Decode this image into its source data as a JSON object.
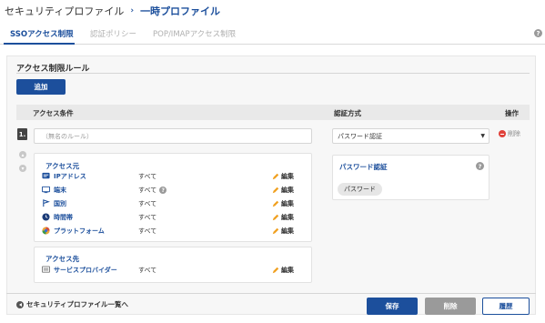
{
  "breadcrumb": {
    "parent": "セキュリティプロファイル",
    "separator": "›",
    "current": "一時プロファイル"
  },
  "tabs": [
    {
      "label": "SSOアクセス制限",
      "active": true
    },
    {
      "label": "認証ポリシー",
      "active": false
    },
    {
      "label": "POP/IMAPアクセス制限",
      "active": false
    }
  ],
  "help": "?",
  "section": {
    "title": "アクセス制限ルール",
    "add_label": "追加"
  },
  "table": {
    "col_condition": "アクセス条件",
    "col_auth": "認証方式",
    "col_action": "操作"
  },
  "rule": {
    "number": "1.",
    "name_placeholder": "（無名のルール）",
    "auth_method": "パスワード認証",
    "delete_label": "削除"
  },
  "source": {
    "title": "アクセス元",
    "items": [
      {
        "label": "IPアドレス",
        "value": "すべて",
        "edit": "編集",
        "icon": "ip-address-icon"
      },
      {
        "label": "端末",
        "value": "すべて",
        "edit": "編集",
        "icon": "device-icon",
        "has_help": true
      },
      {
        "label": "国別",
        "value": "すべて",
        "edit": "編集",
        "icon": "country-icon"
      },
      {
        "label": "時間帯",
        "value": "すべて",
        "edit": "編集",
        "icon": "time-icon"
      },
      {
        "label": "プラットフォーム",
        "value": "すべて",
        "edit": "編集",
        "icon": "platform-icon"
      }
    ]
  },
  "destination": {
    "title": "アクセス先",
    "items": [
      {
        "label": "サービスプロバイダー",
        "value": "すべて",
        "edit": "編集",
        "icon": "service-provider-icon"
      }
    ]
  },
  "auth_box": {
    "title": "パスワード認証",
    "tag": "パスワード"
  },
  "footer": {
    "back_label": "セキュリティプロファイル一覧へ",
    "save_label": "保存",
    "delete_label": "削除",
    "history_label": "履歴"
  },
  "colors": {
    "primary": "#1c4f9c",
    "danger": "#e0413a",
    "muted": "#9a9a9a"
  }
}
